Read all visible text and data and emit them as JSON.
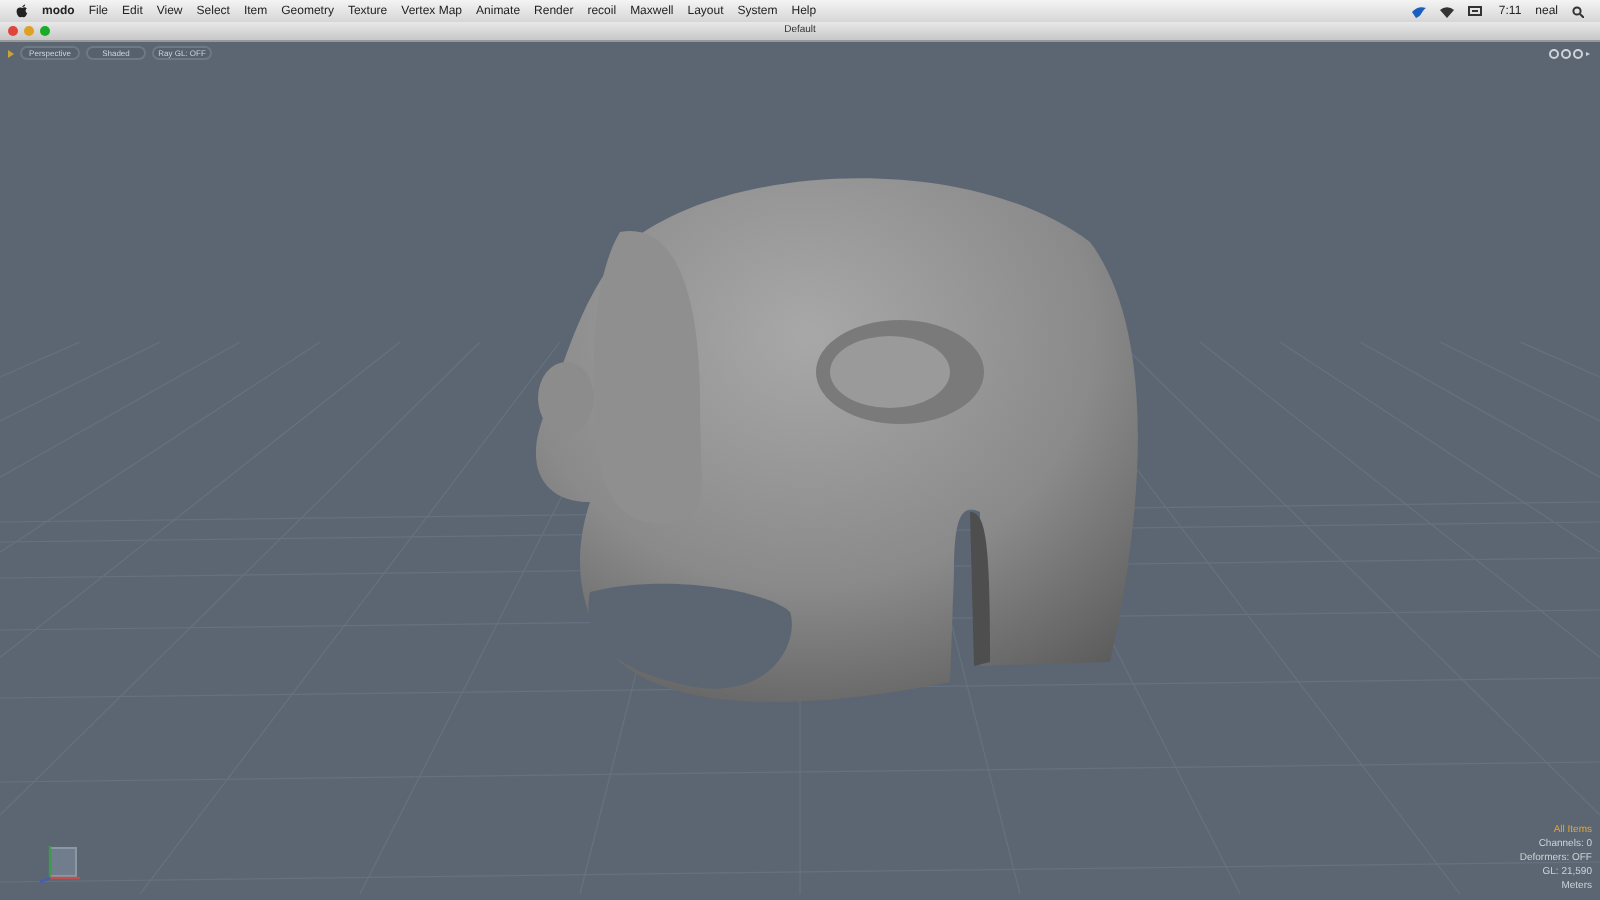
{
  "menu_bar": {
    "app": "modo",
    "items": [
      "File",
      "Edit",
      "View",
      "Select",
      "Item",
      "Geometry",
      "Texture",
      "Vertex Map",
      "Animate",
      "Render",
      "recoil",
      "Maxwell",
      "Layout",
      "System",
      "Help"
    ],
    "clock": "7:11",
    "user": "neal"
  },
  "window": {
    "title": "Default"
  },
  "viewport_toolbar": {
    "buttons": [
      "Perspective",
      "Shaded",
      "Ray GL: OFF"
    ]
  },
  "viewport_info": [
    {
      "text": "All Items",
      "highlighted": true
    },
    {
      "text": "Channels: 0",
      "highlighted": false
    },
    {
      "text": "Deformers: OFF",
      "highlighted": false
    },
    {
      "text": "GL: 21,590",
      "highlighted": false
    },
    {
      "text": "Meters",
      "highlighted": false
    }
  ]
}
